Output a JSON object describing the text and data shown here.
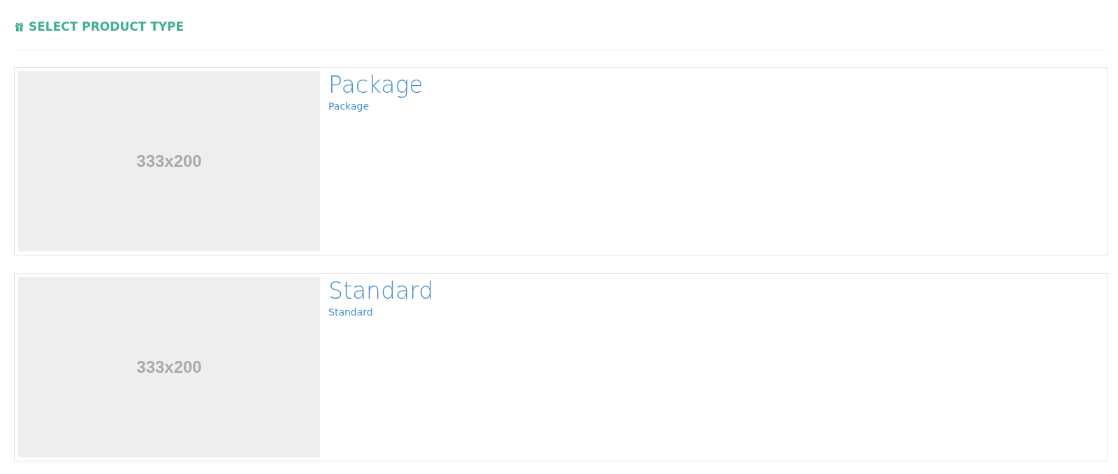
{
  "heading": "SELECT PRODUCT TYPE",
  "products": [
    {
      "image_label": "333x200",
      "title": "Package",
      "subtitle": "Package"
    },
    {
      "image_label": "333x200",
      "title": "Standard",
      "subtitle": "Standard"
    }
  ]
}
